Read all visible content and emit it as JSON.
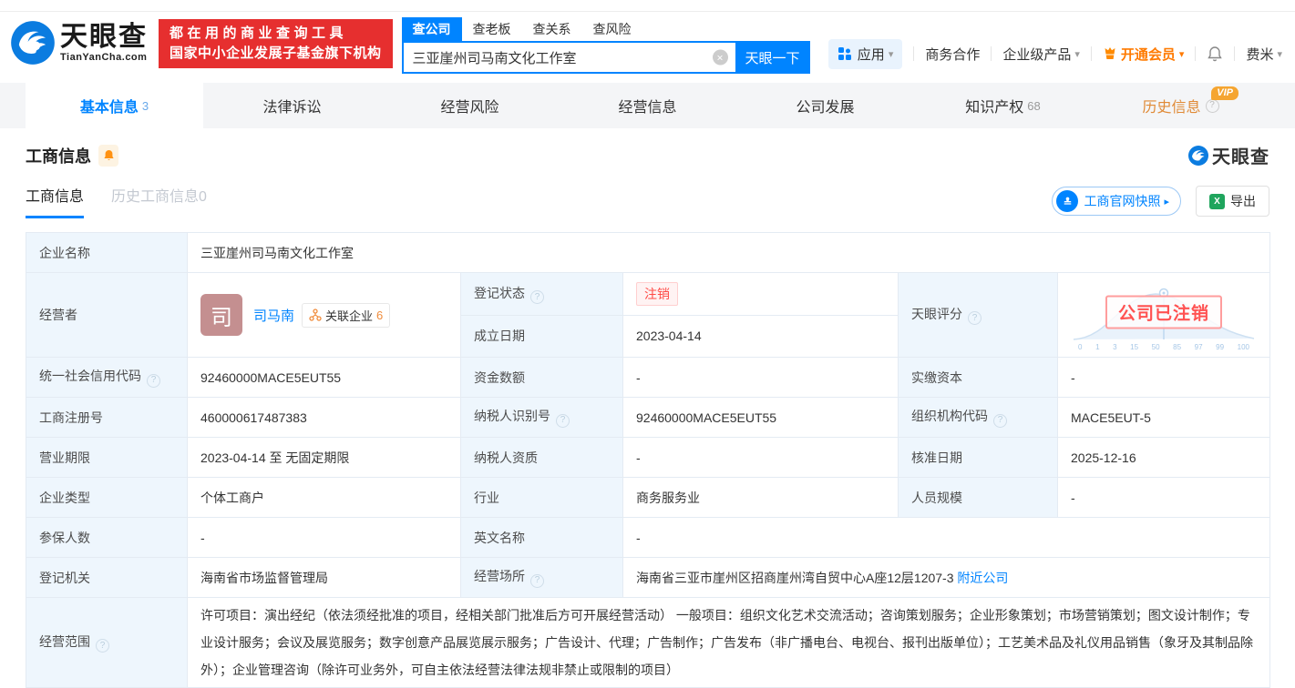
{
  "header": {
    "logo": {
      "title": "天眼查",
      "domain": "TianYanCha.com"
    },
    "slogan": {
      "line1": "都在用的商业查询工具",
      "line2": "国家中小企业发展子基金旗下机构"
    },
    "search": {
      "tabs": [
        "查公司",
        "查老板",
        "查关系",
        "查风险"
      ],
      "value": "三亚崖州司马南文化工作室",
      "button": "天眼一下"
    },
    "nav": {
      "apps": "应用",
      "cooperation": "商务合作",
      "enterprise": "企业级产品",
      "vip": "开通会员",
      "user": "费米"
    }
  },
  "tabs": {
    "basic": {
      "label": "基本信息",
      "count": "3"
    },
    "legal": {
      "label": "法律诉讼"
    },
    "risk": {
      "label": "经营风险"
    },
    "business": {
      "label": "经营信息"
    },
    "development": {
      "label": "公司发展"
    },
    "ip": {
      "label": "知识产权",
      "count": "68"
    },
    "history": {
      "label": "历史信息",
      "vip": "VIP"
    }
  },
  "section": {
    "title": "工商信息",
    "subtab_active": "工商信息",
    "subtab_history": "历史工商信息0",
    "snapshot_button": "工商官网快照",
    "export_button": "导出",
    "watermark": "天眼查"
  },
  "table": {
    "company_name": {
      "label": "企业名称",
      "value": "三亚崖州司马南文化工作室"
    },
    "operator": {
      "label": "经营者",
      "avatar": "司",
      "name": "司马南",
      "related_label": "关联企业",
      "related_count": "6"
    },
    "reg_status": {
      "label": "登记状态",
      "value": "注销"
    },
    "establish_date": {
      "label": "成立日期",
      "value": "2023-04-14"
    },
    "score": {
      "label": "天眼评分",
      "stamp": "公司已注销",
      "axis": [
        "0",
        "1",
        "3",
        "15",
        "50",
        "85",
        "97",
        "99",
        "100"
      ]
    },
    "credit_code": {
      "label": "统一社会信用代码",
      "value": "92460000MACE5EUT55"
    },
    "capital": {
      "label": "资金数额",
      "value": "-"
    },
    "paid_capital": {
      "label": "实缴资本",
      "value": "-"
    },
    "reg_number": {
      "label": "工商注册号",
      "value": "460000617487383"
    },
    "taxpayer_id": {
      "label": "纳税人识别号",
      "value": "92460000MACE5EUT55"
    },
    "org_code": {
      "label": "组织机构代码",
      "value": "MACE5EUT-5"
    },
    "business_term": {
      "label": "营业期限",
      "value": "2023-04-14 至 无固定期限"
    },
    "taxpayer_quality": {
      "label": "纳税人资质",
      "value": "-"
    },
    "approval_date": {
      "label": "核准日期",
      "value": "2025-12-16"
    },
    "company_type": {
      "label": "企业类型",
      "value": "个体工商户"
    },
    "industry": {
      "label": "行业",
      "value": "商务服务业"
    },
    "staff_size": {
      "label": "人员规模",
      "value": "-"
    },
    "insured_count": {
      "label": "参保人数",
      "value": "-"
    },
    "english_name": {
      "label": "英文名称",
      "value": "-"
    },
    "reg_authority": {
      "label": "登记机关",
      "value": "海南省市场监督管理局"
    },
    "business_site": {
      "label": "经营场所",
      "value": "海南省三亚市崖州区招商崖州湾自贸中心A座12层1207-3",
      "link": "附近公司"
    },
    "business_scope": {
      "label": "经营范围",
      "value": "许可项目：演出经纪（依法须经批准的项目，经相关部门批准后方可开展经营活动） 一般项目：组织文化艺术交流活动；咨询策划服务；企业形象策划；市场营销策划；图文设计制作；专业设计服务；会议及展览服务；数字创意产品展览展示服务；广告设计、代理；广告制作；广告发布（非广播电台、电视台、报刊出版单位）；工艺美术品及礼仪用品销售（象牙及其制品除外）；企业管理咨询（除许可业务外，可自主依法经营法律法规非禁止或限制的项目）"
    }
  },
  "icons": {
    "caret": "▾",
    "arrow": "▸",
    "clear": "×",
    "help": "?",
    "excel": "X"
  }
}
